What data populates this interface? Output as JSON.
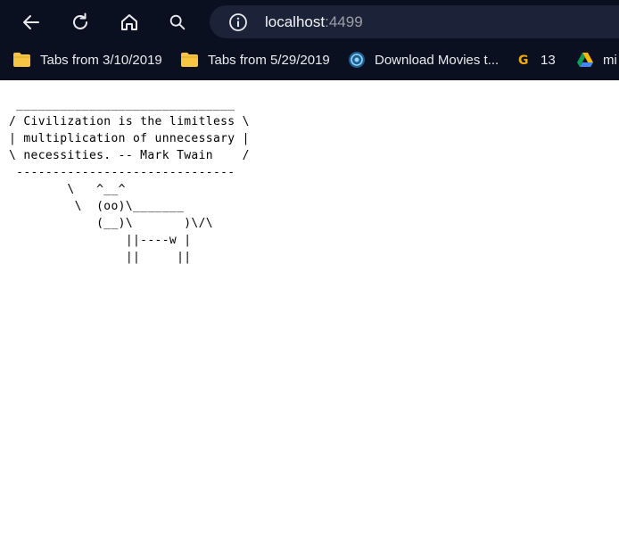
{
  "toolbar": {
    "back_icon": "arrow-left-icon",
    "reload_icon": "reload-icon",
    "home_icon": "home-icon",
    "search_icon": "search-icon"
  },
  "omnibox": {
    "site_info_icon": "info-icon",
    "host": "localhost",
    "port": ":4499"
  },
  "bookmarks": {
    "items": [
      {
        "label": "Tabs from 3/10/2019",
        "icon": "folder-icon"
      },
      {
        "label": "Tabs from 5/29/2019",
        "icon": "folder-icon"
      },
      {
        "label": "Download Movies t...",
        "icon": "site-favicon"
      },
      {
        "label": "13",
        "icon": "g-favicon"
      },
      {
        "label": "mi",
        "icon": "drive-icon"
      }
    ]
  },
  "page": {
    "cowsay": " ______________________________\n/ Civilization is the limitless \\\n| multiplication of unnecessary |\n\\ necessities. -- Mark Twain    /\n ------------------------------\n        \\   ^__^\n         \\  (oo)\\_______\n            (__)\\       )\\/\\\n                ||----w |\n                ||     ||"
  }
}
